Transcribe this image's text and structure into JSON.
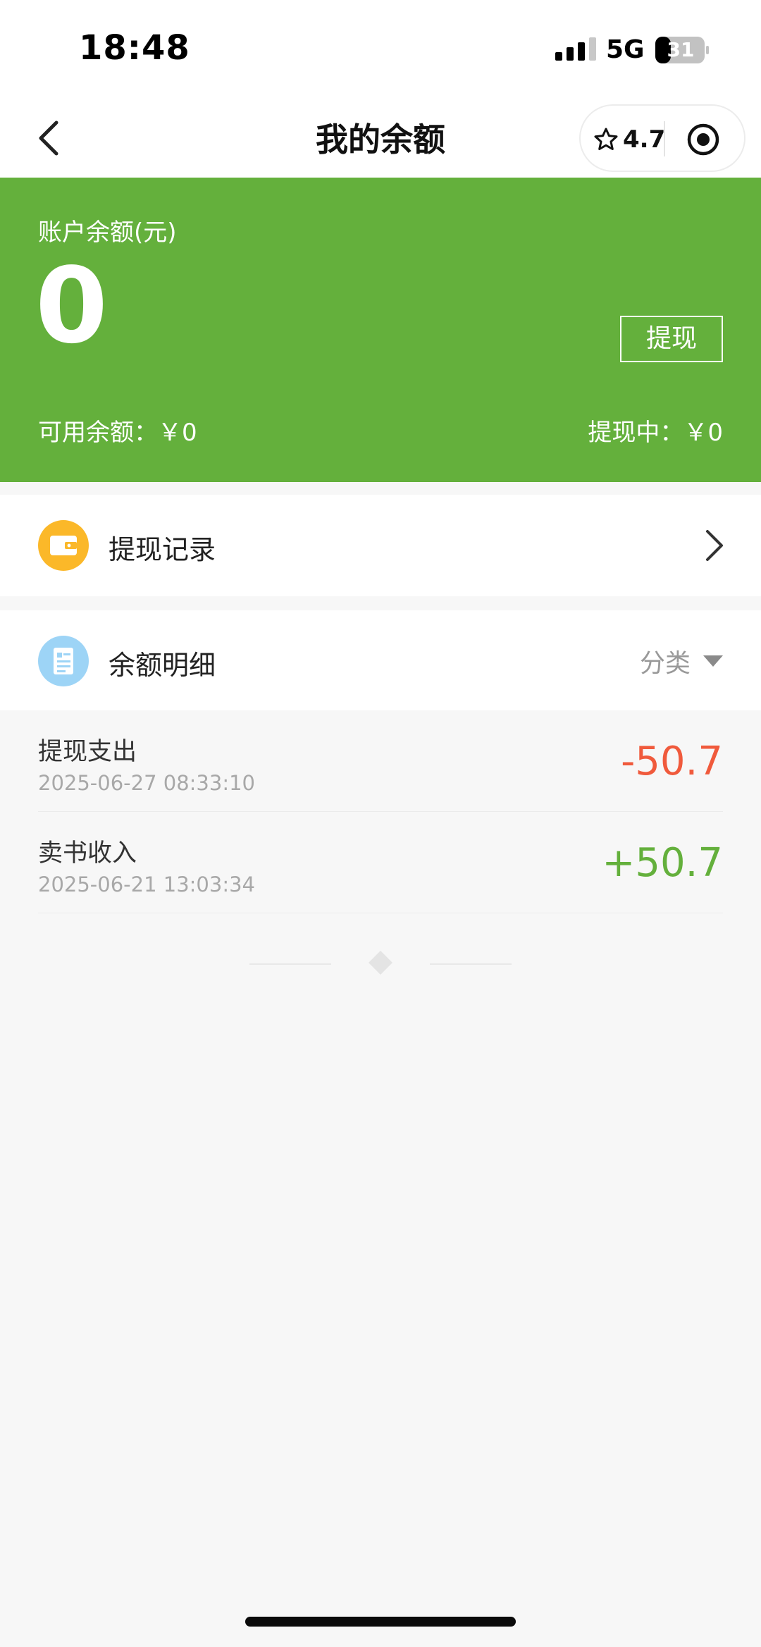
{
  "status_bar": {
    "time": "18:48",
    "network": "5G",
    "battery": "31",
    "signal_icon": "cellular-signal-icon",
    "battery_icon": "battery-icon"
  },
  "nav": {
    "title": "我的余额",
    "back_icon": "chevron-left-icon",
    "rating": "4.7",
    "rating_icon": "star-outline-icon",
    "record_icon": "record-target-icon"
  },
  "balance": {
    "caption": "账户余额(元)",
    "value": "0",
    "withdraw_label": "提现",
    "available": "可用余额：￥0",
    "pending": "提现中：￥0"
  },
  "records": {
    "label": "提现记录",
    "icon": "wallet-icon",
    "arrow_icon": "chevron-right-icon"
  },
  "detail": {
    "label": "余额明细",
    "icon": "document-icon",
    "filter_label": "分类",
    "filter_icon": "caret-down-icon"
  },
  "transactions": [
    {
      "title": "提现支出",
      "time": "2025-06-27 08:33:10",
      "amount": "-50.7",
      "type": "expense"
    },
    {
      "title": "卖书收入",
      "time": "2025-06-21 13:03:34",
      "amount": "+50.7",
      "type": "income"
    }
  ],
  "colors": {
    "brand_green": "#64b03c",
    "expense_red": "#f05a3c",
    "wallet_orange": "#fbb829",
    "document_blue": "#9dd4f6"
  }
}
